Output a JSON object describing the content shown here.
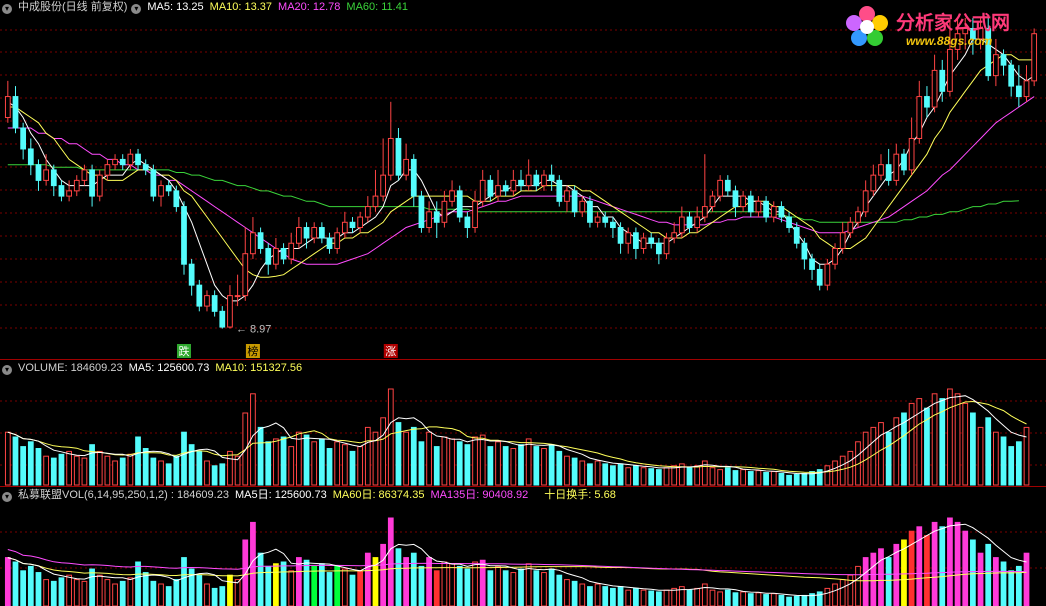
{
  "colors": {
    "up": "#ff4444",
    "down": "#54fcfc",
    "ma5": "#ffffff",
    "ma10": "#ffff5a",
    "ma20": "#ff4cff",
    "ma60": "#3ad43a",
    "grid": "#7a0000",
    "separator": "#a00000",
    "bg": "#000000",
    "label": "#c0c0c0"
  },
  "logo": {
    "title": "分析家公式网",
    "url": "www.88gs.com"
  },
  "price_header": {
    "icon": "dropdown-circle-icon",
    "stock": "中成股份(日线 前复权)",
    "ma5": "MA5: 13.25",
    "ma10": "MA10: 13.37",
    "ma20": "MA20: 12.78",
    "ma60": "MA60: 11.41"
  },
  "volume_header": {
    "icon": "dropdown-circle-icon",
    "volume": "VOLUME: 184609.23",
    "ma5": "MA5: 125600.73",
    "ma10": "MA10: 151327.56"
  },
  "indicator_header": {
    "icon": "dropdown-circle-icon",
    "name": "私募联盟VOL(6,14,95,250,1,2) : 184609.23",
    "ma5": "MA5日: 125600.73",
    "ma60": "MA60日: 86374.35",
    "ma135": "MA135日: 90408.92",
    "turnover": "十日换手: 5.68"
  },
  "markers": [
    {
      "text": "跌",
      "index": 23,
      "color": "#2ea82e",
      "textColor": "#ffffff"
    },
    {
      "text": "榜",
      "index": 32,
      "color": "#c89a00",
      "textColor": "#000000"
    },
    {
      "text": "涨",
      "index": 50,
      "color": "#b00000",
      "textColor": "#ffffff"
    }
  ],
  "low_annotation": "8.97",
  "chart_data": {
    "type": "candlestick",
    "price_range": [
      8.6,
      14.9
    ],
    "candles": [
      [
        13.0,
        13.4,
        13.7,
        12.9
      ],
      [
        13.4,
        12.8,
        13.6,
        12.7
      ],
      [
        12.8,
        12.4,
        12.9,
        12.2
      ],
      [
        12.4,
        12.1,
        12.6,
        11.9
      ],
      [
        12.1,
        11.8,
        12.2,
        11.6
      ],
      [
        11.8,
        12.0,
        12.3,
        11.7
      ],
      [
        12.0,
        11.7,
        12.1,
        11.5
      ],
      [
        11.7,
        11.5,
        11.8,
        11.4
      ],
      [
        11.5,
        11.6,
        11.8,
        11.4
      ],
      [
        11.6,
        11.8,
        11.9,
        11.5
      ],
      [
        11.8,
        12.0,
        12.1,
        11.7
      ],
      [
        12.0,
        11.5,
        12.1,
        11.3
      ],
      [
        11.5,
        11.9,
        12.0,
        11.4
      ],
      [
        11.9,
        12.1,
        12.2,
        11.8
      ],
      [
        12.1,
        12.2,
        12.3,
        12.0
      ],
      [
        12.2,
        12.1,
        12.3,
        12.0
      ],
      [
        12.1,
        12.3,
        12.4,
        12.0
      ],
      [
        12.3,
        12.1,
        12.4,
        12.0
      ],
      [
        12.1,
        12.0,
        12.2,
        11.9
      ],
      [
        12.0,
        11.5,
        12.1,
        11.4
      ],
      [
        11.5,
        11.7,
        11.8,
        11.3
      ],
      [
        11.7,
        11.6,
        11.8,
        11.5
      ],
      [
        11.6,
        11.3,
        11.7,
        11.2
      ],
      [
        11.3,
        10.2,
        11.4,
        10.0
      ],
      [
        10.2,
        9.8,
        10.3,
        9.6
      ],
      [
        9.8,
        9.4,
        9.9,
        9.3
      ],
      [
        9.4,
        9.6,
        9.7,
        9.3
      ],
      [
        9.6,
        9.3,
        9.7,
        9.2
      ],
      [
        9.3,
        9.0,
        9.4,
        8.97
      ],
      [
        9.0,
        9.6,
        9.8,
        8.97
      ],
      [
        9.6,
        9.6,
        10.0,
        9.4
      ],
      [
        9.6,
        10.4,
        10.9,
        9.5
      ],
      [
        10.4,
        10.8,
        11.1,
        10.3
      ],
      [
        10.8,
        10.5,
        10.9,
        10.4
      ],
      [
        10.5,
        10.2,
        10.6,
        10.0
      ],
      [
        10.2,
        10.5,
        10.7,
        10.1
      ],
      [
        10.5,
        10.3,
        10.6,
        10.2
      ],
      [
        10.3,
        10.6,
        10.8,
        10.2
      ],
      [
        10.6,
        10.9,
        11.1,
        10.5
      ],
      [
        10.9,
        10.7,
        11.0,
        10.5
      ],
      [
        10.7,
        10.9,
        11.0,
        10.6
      ],
      [
        10.9,
        10.7,
        11.0,
        10.6
      ],
      [
        10.7,
        10.5,
        10.8,
        10.4
      ],
      [
        10.5,
        10.8,
        10.9,
        10.4
      ],
      [
        10.8,
        11.0,
        11.2,
        10.7
      ],
      [
        11.0,
        10.9,
        11.1,
        10.8
      ],
      [
        10.9,
        11.1,
        11.2,
        10.8
      ],
      [
        11.1,
        11.3,
        11.5,
        11.0
      ],
      [
        11.3,
        11.5,
        12.0,
        11.2
      ],
      [
        11.5,
        11.9,
        12.6,
        11.4
      ],
      [
        11.9,
        12.6,
        13.3,
        11.8
      ],
      [
        12.6,
        11.9,
        12.8,
        11.8
      ],
      [
        11.9,
        12.2,
        12.5,
        11.8
      ],
      [
        12.2,
        11.5,
        12.3,
        11.3
      ],
      [
        11.5,
        10.9,
        11.6,
        10.8
      ],
      [
        10.9,
        11.2,
        11.4,
        10.8
      ],
      [
        11.2,
        11.0,
        11.4,
        10.7
      ],
      [
        11.0,
        11.4,
        11.6,
        10.9
      ],
      [
        11.4,
        11.6,
        11.8,
        11.3
      ],
      [
        11.6,
        11.1,
        11.7,
        11.0
      ],
      [
        11.1,
        10.9,
        11.2,
        10.7
      ],
      [
        10.9,
        11.4,
        11.6,
        10.8
      ],
      [
        11.4,
        11.8,
        12.0,
        11.3
      ],
      [
        11.8,
        11.5,
        11.9,
        11.4
      ],
      [
        11.5,
        11.7,
        12.0,
        11.4
      ],
      [
        11.7,
        11.6,
        11.8,
        11.5
      ],
      [
        11.6,
        11.8,
        12.0,
        11.5
      ],
      [
        11.8,
        11.7,
        12.0,
        11.6
      ],
      [
        11.7,
        11.9,
        12.2,
        11.6
      ],
      [
        11.9,
        11.7,
        12.0,
        11.6
      ],
      [
        11.7,
        11.9,
        12.0,
        11.6
      ],
      [
        11.9,
        11.8,
        12.1,
        11.6
      ],
      [
        11.8,
        11.4,
        11.9,
        11.3
      ],
      [
        11.4,
        11.6,
        11.7,
        11.2
      ],
      [
        11.6,
        11.2,
        11.7,
        11.1
      ],
      [
        11.2,
        11.4,
        11.5,
        11.1
      ],
      [
        11.4,
        11.0,
        11.5,
        10.9
      ],
      [
        11.0,
        11.1,
        11.2,
        10.9
      ],
      [
        11.1,
        11.0,
        11.2,
        10.9
      ],
      [
        11.0,
        10.9,
        11.1,
        10.7
      ],
      [
        10.9,
        10.6,
        11.0,
        10.4
      ],
      [
        10.6,
        10.8,
        10.9,
        10.4
      ],
      [
        10.8,
        10.5,
        10.9,
        10.3
      ],
      [
        10.5,
        10.7,
        10.8,
        10.4
      ],
      [
        10.7,
        10.6,
        10.8,
        10.5
      ],
      [
        10.6,
        10.4,
        10.7,
        10.2
      ],
      [
        10.4,
        10.7,
        10.8,
        10.3
      ],
      [
        10.7,
        10.8,
        11.0,
        10.6
      ],
      [
        10.8,
        11.1,
        11.3,
        10.7
      ],
      [
        11.1,
        10.9,
        11.2,
        10.8
      ],
      [
        10.9,
        11.1,
        11.3,
        10.8
      ],
      [
        11.1,
        11.3,
        12.3,
        11.0
      ],
      [
        11.3,
        11.5,
        11.6,
        11.2
      ],
      [
        11.5,
        11.8,
        11.9,
        11.4
      ],
      [
        11.8,
        11.6,
        11.9,
        11.5
      ],
      [
        11.6,
        11.3,
        11.7,
        11.1
      ],
      [
        11.3,
        11.5,
        11.6,
        11.2
      ],
      [
        11.5,
        11.2,
        11.6,
        11.1
      ],
      [
        11.2,
        11.4,
        11.5,
        11.1
      ],
      [
        11.4,
        11.1,
        11.5,
        11.0
      ],
      [
        11.1,
        11.3,
        11.4,
        11.0
      ],
      [
        11.3,
        11.1,
        11.4,
        11.0
      ],
      [
        11.1,
        10.9,
        11.2,
        10.8
      ],
      [
        10.9,
        10.6,
        11.0,
        10.5
      ],
      [
        10.6,
        10.3,
        10.7,
        10.1
      ],
      [
        10.3,
        10.1,
        10.4,
        9.9
      ],
      [
        10.1,
        9.8,
        10.2,
        9.7
      ],
      [
        9.8,
        10.2,
        10.3,
        9.7
      ],
      [
        10.2,
        10.5,
        10.6,
        10.1
      ],
      [
        10.5,
        10.8,
        11.0,
        10.4
      ],
      [
        10.8,
        11.0,
        11.1,
        10.7
      ],
      [
        11.0,
        11.2,
        11.3,
        10.9
      ],
      [
        11.2,
        11.6,
        11.8,
        11.1
      ],
      [
        11.6,
        11.9,
        12.1,
        11.5
      ],
      [
        11.9,
        12.1,
        12.3,
        11.8
      ],
      [
        12.1,
        11.8,
        12.4,
        11.7
      ],
      [
        11.8,
        12.3,
        12.5,
        11.7
      ],
      [
        12.3,
        12.0,
        12.4,
        11.9
      ],
      [
        12.0,
        12.6,
        13.0,
        11.9
      ],
      [
        12.6,
        13.4,
        13.7,
        12.5
      ],
      [
        13.4,
        13.2,
        13.6,
        13.0
      ],
      [
        13.2,
        13.9,
        14.2,
        13.1
      ],
      [
        13.9,
        13.5,
        14.1,
        13.3
      ],
      [
        13.5,
        14.3,
        14.9,
        13.4
      ],
      [
        14.3,
        14.6,
        14.9,
        14.1
      ],
      [
        14.6,
        14.7,
        14.9,
        14.3
      ],
      [
        14.7,
        14.5,
        14.9,
        14.2
      ],
      [
        14.5,
        14.7,
        14.9,
        14.3
      ],
      [
        14.7,
        13.8,
        14.9,
        13.7
      ],
      [
        13.8,
        14.2,
        14.5,
        13.6
      ],
      [
        14.2,
        14.0,
        14.3,
        13.8
      ],
      [
        14.0,
        13.6,
        14.1,
        13.4
      ],
      [
        13.6,
        13.4,
        14.0,
        13.2
      ],
      [
        13.4,
        13.7,
        14.0,
        13.3
      ],
      [
        13.7,
        14.6,
        14.7,
        13.6
      ]
    ],
    "ma5": [
      13.3,
      13.2,
      13.0,
      12.7,
      12.5,
      12.2,
      12.0,
      11.8,
      11.7,
      11.7,
      11.7,
      11.7,
      11.8,
      11.9,
      11.9,
      11.9,
      12.1,
      12.2,
      12.1,
      12.0,
      11.9,
      11.8,
      11.6,
      11.3,
      11.0,
      10.6,
      10.2,
      9.8,
      9.6,
      9.5,
      9.5,
      9.6,
      9.8,
      10.1,
      10.3,
      10.4,
      10.5,
      10.5,
      10.5,
      10.6,
      10.7,
      10.7,
      10.7,
      10.7,
      10.8,
      10.8,
      10.9,
      11.0,
      11.1,
      11.3,
      11.7,
      11.8,
      12.0,
      12.0,
      11.8,
      11.5,
      11.2,
      11.1,
      11.2,
      11.3,
      11.3,
      11.3,
      11.4,
      11.5,
      11.6,
      11.6,
      11.7,
      11.7,
      11.7,
      11.7,
      11.8,
      11.8,
      11.7,
      11.7,
      11.6,
      11.5,
      11.3,
      11.3,
      11.1,
      11.1,
      10.9,
      10.8,
      10.7,
      10.6,
      10.6,
      10.6,
      10.6,
      10.7,
      10.8,
      10.9,
      11.0,
      11.1,
      11.3,
      11.5,
      11.5,
      11.5,
      11.5,
      11.4,
      11.4,
      11.3,
      11.2,
      11.2,
      11.0,
      10.8,
      10.6,
      10.3,
      10.2,
      10.2,
      10.3,
      10.5,
      10.8,
      11.0,
      11.3,
      11.5,
      11.7,
      11.9,
      12.0,
      12.2,
      12.5,
      12.7,
      13.0,
      13.2,
      13.5,
      13.8,
      14.0,
      14.2,
      14.5,
      14.5,
      14.4,
      14.3,
      14.2,
      14.0,
      13.8,
      13.7,
      13.8
    ],
    "ma10": [
      13.2,
      13.2,
      13.1,
      13.0,
      12.9,
      12.7,
      12.6,
      12.4,
      12.2,
      12.1,
      12.0,
      11.9,
      11.9,
      11.8,
      11.8,
      11.8,
      11.9,
      12.0,
      12.0,
      12.0,
      11.9,
      11.9,
      11.8,
      11.6,
      11.5,
      11.3,
      11.1,
      10.9,
      10.7,
      10.5,
      10.3,
      10.1,
      10.0,
      9.95,
      9.95,
      9.97,
      10.0,
      10.1,
      10.2,
      10.3,
      10.4,
      10.5,
      10.6,
      10.6,
      10.7,
      10.7,
      10.8,
      10.8,
      10.9,
      11.0,
      11.2,
      11.3,
      11.4,
      11.5,
      11.5,
      11.5,
      11.5,
      11.5,
      11.5,
      11.5,
      11.5,
      11.4,
      11.4,
      11.4,
      11.5,
      11.5,
      11.5,
      11.6,
      11.6,
      11.6,
      11.7,
      11.7,
      11.7,
      11.7,
      11.7,
      11.6,
      11.6,
      11.5,
      11.4,
      11.3,
      11.2,
      11.1,
      11.0,
      10.9,
      10.8,
      10.8,
      10.7,
      10.7,
      10.7,
      10.8,
      10.8,
      10.9,
      11.0,
      11.1,
      11.2,
      11.3,
      11.3,
      11.4,
      11.4,
      11.4,
      11.3,
      11.3,
      11.2,
      11.1,
      11.0,
      10.9,
      10.7,
      10.6,
      10.5,
      10.5,
      10.5,
      10.6,
      10.7,
      10.9,
      11.1,
      11.3,
      11.5,
      11.7,
      11.9,
      12.1,
      12.3,
      12.6,
      12.8,
      13.1,
      13.3,
      13.5,
      13.7,
      13.9,
      14.0,
      14.1,
      14.2,
      14.2,
      14.1,
      14.1,
      14.1
    ],
    "ma20": [
      12.8,
      12.8,
      12.8,
      12.8,
      12.7,
      12.7,
      12.6,
      12.6,
      12.5,
      12.5,
      12.4,
      12.3,
      12.3,
      12.2,
      12.2,
      12.1,
      12.1,
      12.0,
      12.0,
      11.9,
      11.9,
      11.8,
      11.8,
      11.7,
      11.6,
      11.5,
      11.4,
      11.3,
      11.2,
      11.1,
      11.0,
      10.9,
      10.8,
      10.7,
      10.6,
      10.5,
      10.4,
      10.3,
      10.25,
      10.2,
      10.2,
      10.2,
      10.2,
      10.2,
      10.25,
      10.3,
      10.35,
      10.4,
      10.5,
      10.6,
      10.7,
      10.8,
      10.9,
      10.95,
      11.0,
      11.05,
      11.1,
      11.15,
      11.2,
      11.2,
      11.2,
      11.25,
      11.3,
      11.35,
      11.4,
      11.4,
      11.45,
      11.5,
      11.5,
      11.5,
      11.5,
      11.5,
      11.5,
      11.5,
      11.5,
      11.5,
      11.45,
      11.4,
      11.35,
      11.3,
      11.25,
      11.2,
      11.15,
      11.1,
      11.05,
      11.0,
      11.0,
      10.95,
      10.95,
      10.95,
      10.95,
      10.95,
      11.0,
      11.0,
      11.05,
      11.05,
      11.1,
      11.1,
      11.1,
      11.1,
      11.1,
      11.05,
      11.0,
      10.95,
      10.9,
      10.85,
      10.8,
      10.8,
      10.8,
      10.8,
      10.85,
      10.9,
      10.95,
      11.0,
      11.05,
      11.1,
      11.2,
      11.3,
      11.4,
      11.5,
      11.6,
      11.75,
      11.9,
      12.0,
      12.15,
      12.3,
      12.45,
      12.6,
      12.75,
      12.9,
      13.0,
      13.1,
      13.2,
      13.3,
      13.4
    ],
    "ma60": [
      12.1,
      12.1,
      12.1,
      12.1,
      12.1,
      12.1,
      12.05,
      12.05,
      12.05,
      12.05,
      12.0,
      12.0,
      12.0,
      12.0,
      12.0,
      12.0,
      12.0,
      12.0,
      12.0,
      12.0,
      12.0,
      12.0,
      11.95,
      11.95,
      11.9,
      11.9,
      11.85,
      11.8,
      11.8,
      11.75,
      11.7,
      11.7,
      11.65,
      11.6,
      11.6,
      11.55,
      11.5,
      11.5,
      11.45,
      11.4,
      11.4,
      11.35,
      11.3,
      11.3,
      11.3,
      11.3,
      11.3,
      11.3,
      11.3,
      11.3,
      11.3,
      11.3,
      11.3,
      11.3,
      11.3,
      11.25,
      11.25,
      11.25,
      11.25,
      11.25,
      11.25,
      11.2,
      11.2,
      11.2,
      11.2,
      11.2,
      11.2,
      11.2,
      11.2,
      11.2,
      11.2,
      11.2,
      11.2,
      11.2,
      11.2,
      11.2,
      11.2,
      11.2,
      11.2,
      11.2,
      11.2,
      11.2,
      11.2,
      11.2,
      11.2,
      11.2,
      11.2,
      11.2,
      11.2,
      11.2,
      11.2,
      11.2,
      11.2,
      11.2,
      11.2,
      11.2,
      11.2,
      11.2,
      11.2,
      11.2,
      11.15,
      11.15,
      11.1,
      11.1,
      11.05,
      11.05,
      11.0,
      11.0,
      11.0,
      11.0,
      11.0,
      11.0,
      11.0,
      11.0,
      11.0,
      11.0,
      11.0,
      11.05,
      11.05,
      11.1,
      11.1,
      11.15,
      11.15,
      11.2,
      11.2,
      11.25,
      11.3,
      11.3,
      11.35,
      11.35,
      11.4,
      11.4,
      11.41
    ],
    "volume": [
      0.55,
      0.5,
      0.4,
      0.45,
      0.38,
      0.3,
      0.28,
      0.32,
      0.35,
      0.3,
      0.28,
      0.42,
      0.35,
      0.3,
      0.25,
      0.28,
      0.32,
      0.5,
      0.38,
      0.28,
      0.25,
      0.22,
      0.3,
      0.55,
      0.42,
      0.35,
      0.25,
      0.2,
      0.22,
      0.35,
      0.3,
      0.75,
      0.95,
      0.6,
      0.45,
      0.48,
      0.5,
      0.4,
      0.55,
      0.52,
      0.45,
      0.48,
      0.38,
      0.45,
      0.42,
      0.35,
      0.4,
      0.6,
      0.55,
      0.7,
      1.0,
      0.65,
      0.55,
      0.6,
      0.45,
      0.55,
      0.4,
      0.5,
      0.48,
      0.45,
      0.42,
      0.5,
      0.52,
      0.4,
      0.45,
      0.4,
      0.38,
      0.42,
      0.48,
      0.4,
      0.38,
      0.42,
      0.35,
      0.3,
      0.28,
      0.25,
      0.22,
      0.25,
      0.22,
      0.2,
      0.22,
      0.18,
      0.2,
      0.18,
      0.17,
      0.16,
      0.18,
      0.2,
      0.22,
      0.18,
      0.2,
      0.25,
      0.18,
      0.16,
      0.18,
      0.15,
      0.16,
      0.14,
      0.15,
      0.13,
      0.14,
      0.12,
      0.1,
      0.11,
      0.12,
      0.14,
      0.16,
      0.2,
      0.25,
      0.3,
      0.35,
      0.45,
      0.55,
      0.6,
      0.65,
      0.55,
      0.7,
      0.75,
      0.85,
      0.9,
      0.8,
      0.95,
      0.9,
      1.0,
      0.95,
      0.85,
      0.75,
      0.6,
      0.7,
      0.55,
      0.5,
      0.4,
      0.45,
      0.6
    ],
    "turnover_hl": {
      "29": "#ffff00",
      "35": "#ffff00",
      "40": "#00ff3a",
      "43": "#00ff3a",
      "46": "#ff3030",
      "48": "#ffff00",
      "56": "#ff3030",
      "117": "#ffff00",
      "118": "#ff3030",
      "120": "#ff3030"
    }
  }
}
